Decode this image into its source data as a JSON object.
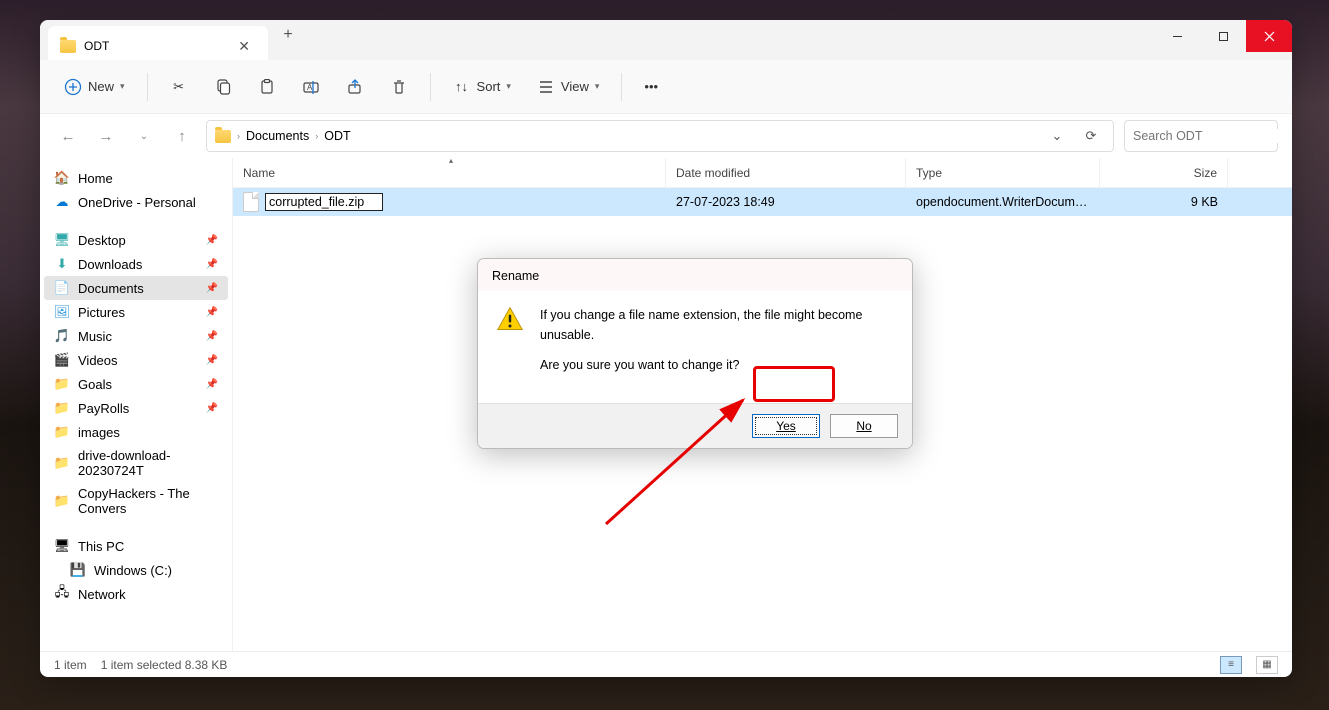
{
  "tab": {
    "title": "ODT"
  },
  "toolbar": {
    "new": "New",
    "sort": "Sort",
    "view": "View"
  },
  "breadcrumb": {
    "a": "Documents",
    "b": "ODT"
  },
  "search": {
    "placeholder": "Search ODT"
  },
  "sidebar": {
    "home": "Home",
    "onedrive": "OneDrive - Personal",
    "quick": [
      {
        "label": "Desktop",
        "icon": "desktop",
        "pinned": true
      },
      {
        "label": "Downloads",
        "icon": "download",
        "pinned": true
      },
      {
        "label": "Documents",
        "icon": "docs",
        "pinned": true,
        "selected": true
      },
      {
        "label": "Pictures",
        "icon": "pics",
        "pinned": true
      },
      {
        "label": "Music",
        "icon": "music",
        "pinned": true
      },
      {
        "label": "Videos",
        "icon": "video",
        "pinned": true
      },
      {
        "label": "Goals",
        "icon": "folder",
        "pinned": true
      },
      {
        "label": "PayRolls",
        "icon": "folder",
        "pinned": true
      },
      {
        "label": "images",
        "icon": "folder",
        "pinned": false
      },
      {
        "label": "drive-download-20230724T",
        "icon": "folder",
        "pinned": false
      },
      {
        "label": "CopyHackers - The Convers",
        "icon": "folder",
        "pinned": false
      }
    ],
    "thispc": "This PC",
    "drive": "Windows (C:)",
    "network": "Network"
  },
  "columns": {
    "name": "Name",
    "date": "Date modified",
    "type": "Type",
    "size": "Size"
  },
  "file": {
    "rename_value": "corrupted_file.zip",
    "date": "27-07-2023 18:49",
    "type": "opendocument.WriterDocumen...",
    "size": "9 KB"
  },
  "status": {
    "count": "1 item",
    "selected": "1 item selected  8.38 KB"
  },
  "dialog": {
    "title": "Rename",
    "line1": "If you change a file name extension, the file might become unusable.",
    "line2": "Are you sure you want to change it?",
    "yes": "Yes",
    "no": "No"
  }
}
